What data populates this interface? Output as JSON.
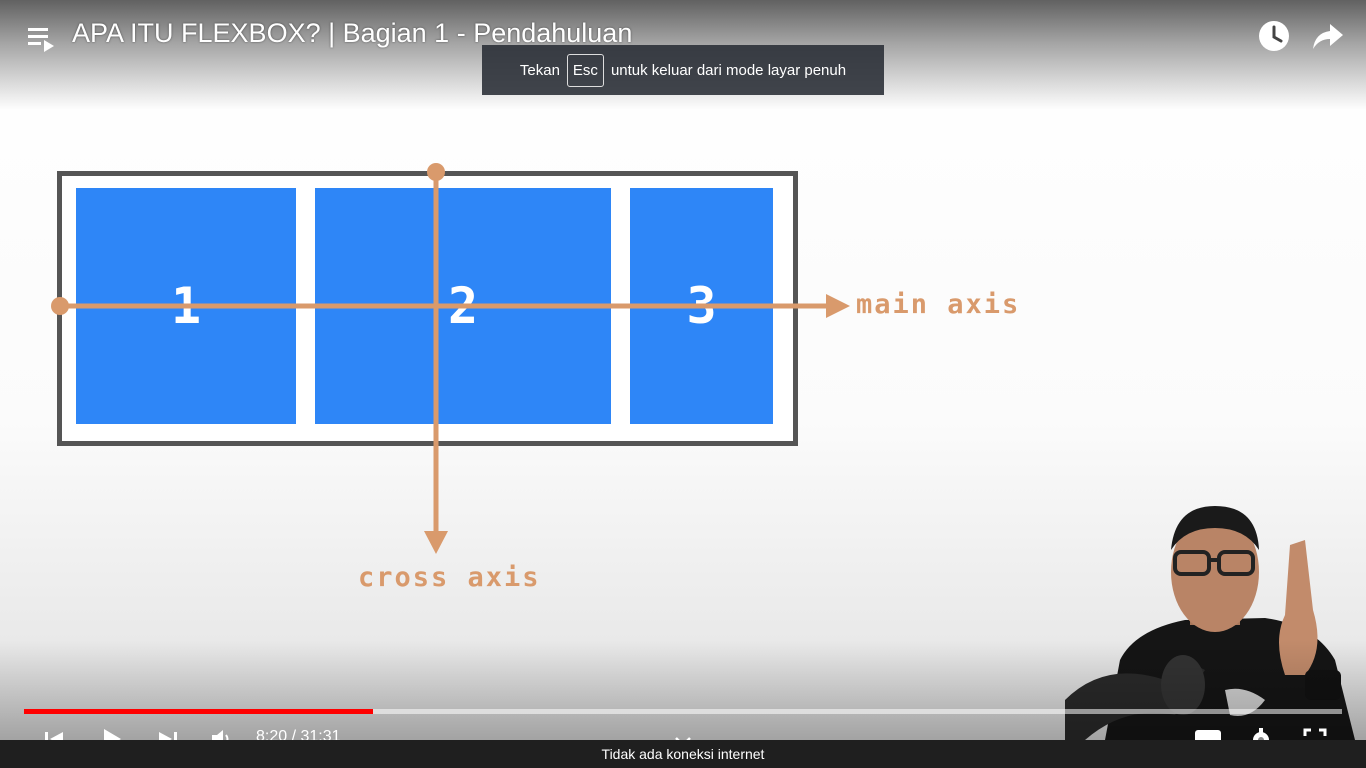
{
  "video": {
    "title": "APA ITU FLEXBOX? | Bagian 1 - Pendahuluan",
    "current_time": "8:20",
    "duration": "31:31",
    "progress": 0.265
  },
  "fullscreen_toast": {
    "before": "Tekan",
    "key": "Esc",
    "after": "untuk keluar dari mode layar penuh"
  },
  "slide": {
    "items": [
      "1",
      "2",
      "3"
    ],
    "main_axis_label": "main axis",
    "cross_axis_label": "cross axis",
    "item_color": "#2e86f7",
    "axis_color": "#d99a6c",
    "border_color": "#555555"
  },
  "icons": {
    "playlist": "playlist-icon",
    "watch_later": "clock-icon",
    "share": "share-icon",
    "previous": "skip-previous-icon",
    "play": "play-icon",
    "next": "skip-next-icon",
    "volume": "volume-icon",
    "chevron": "chevron-down-icon",
    "subtitles": "subtitles-icon",
    "settings": "gear-icon",
    "fullscreen": "fullscreen-icon"
  },
  "status": {
    "message": "Tidak ada koneksi internet"
  },
  "colors": {
    "progress": "#ff0000",
    "status_bar": "#1f1f1f"
  }
}
